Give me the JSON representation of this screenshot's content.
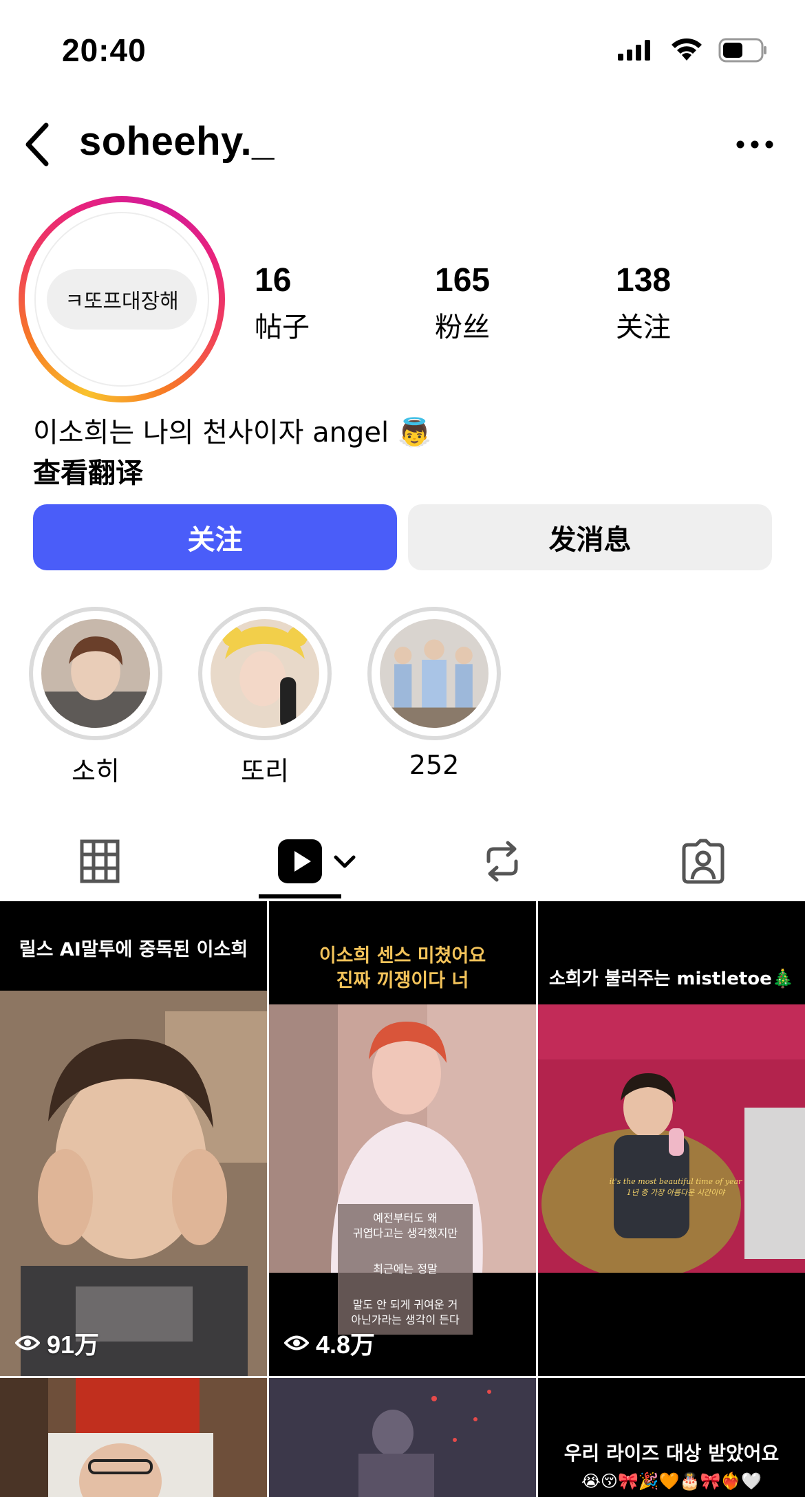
{
  "status": {
    "time": "20:40"
  },
  "header": {
    "username": "soheehy._"
  },
  "profile": {
    "note": "ㅋ또프대장해",
    "stats": [
      {
        "value": "16",
        "label": "帖子"
      },
      {
        "value": "165",
        "label": "粉丝"
      },
      {
        "value": "138",
        "label": "关注"
      }
    ],
    "bio": "이소희는 나의 천사이자 angel 👼",
    "translate_label": "查看翻译"
  },
  "actions": {
    "follow_label": "关注",
    "message_label": "发消息"
  },
  "highlights": [
    {
      "label": "소히"
    },
    {
      "label": "또리"
    },
    {
      "label": "252"
    }
  ],
  "tabs": [
    "grid",
    "reels",
    "reposts",
    "tagged"
  ],
  "grid": [
    {
      "caption": "릴스 AI말투에 중독된 이소희",
      "views": "91万"
    },
    {
      "caption_line1": "이소희 센스 미쳤어요",
      "caption_line2": "진짜 끼쟁이다 너",
      "views": "4.8万",
      "subtitle1": "예전부터도 왜",
      "subtitle2": "귀엽다고는 생각했지만",
      "subtitle3": "최근에는 정말",
      "subtitle4": "말도 안 되게 귀여운 거",
      "subtitle5": "아닌가라는 생각이 든다"
    },
    {
      "caption": "소희가 불러주는 mistletoe🎄",
      "overlay1": "it's the most beautiful time of year",
      "overlay2": "1년 중 가장 아름다운 시간이야"
    },
    {
      "caption": ""
    },
    {
      "caption": ""
    },
    {
      "caption_line1": "우리 라이즈 대상 받았어요",
      "caption_line2": "😭😚🎀🎉🧡🎂🎀❤️‍🔥🤍"
    }
  ],
  "colors": {
    "follow_button": "#4a5df9",
    "secondary_button": "#efefef"
  }
}
